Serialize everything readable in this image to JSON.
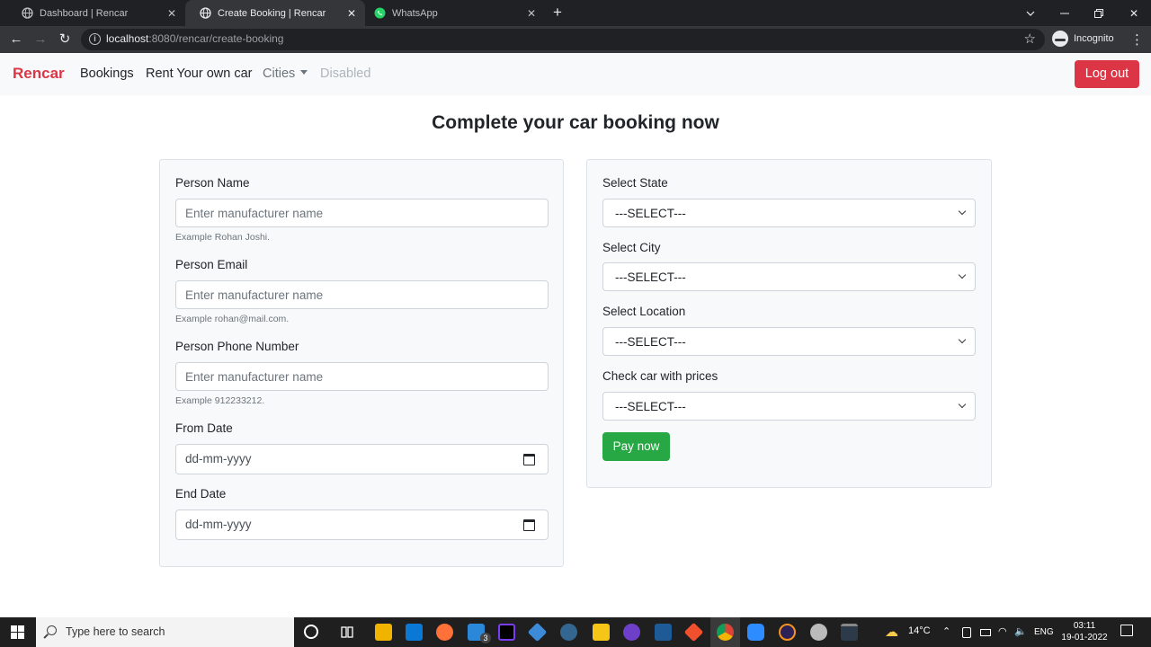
{
  "browser": {
    "tabs": [
      {
        "title": "Dashboard | Rencar",
        "active": false
      },
      {
        "title": "Create Booking | Rencar",
        "active": true
      },
      {
        "title": "WhatsApp",
        "active": false
      }
    ],
    "url_host": "localhost",
    "url_path": ":8080/rencar/create-booking",
    "profile_label": "Incognito"
  },
  "navbar": {
    "brand": "Rencar",
    "links": [
      "Bookings",
      "Rent Your own car",
      "Cities",
      "Disabled"
    ],
    "logout_label": "Log out"
  },
  "page": {
    "heading": "Complete your car booking now"
  },
  "left_form": {
    "person_name": {
      "label": "Person Name",
      "placeholder": "Enter manufacturer name",
      "help": "Example Rohan Joshi."
    },
    "person_email": {
      "label": "Person Email",
      "placeholder": "Enter manufacturer name",
      "help": "Example rohan@mail.com."
    },
    "person_phone": {
      "label": "Person Phone Number",
      "placeholder": "Enter manufacturer name",
      "help": "Example 912233212."
    },
    "from_date": {
      "label": "From Date",
      "value": "dd-mm-yyyy"
    },
    "end_date": {
      "label": "End Date",
      "value": "dd-mm-yyyy"
    }
  },
  "right_form": {
    "state": {
      "label": "Select State",
      "selected": "---SELECT---"
    },
    "city": {
      "label": "Select City",
      "selected": "---SELECT---"
    },
    "location": {
      "label": "Select Location",
      "selected": "---SELECT---"
    },
    "car": {
      "label": "Check car with prices",
      "selected": "---SELECT---"
    },
    "pay_label": "Pay now"
  },
  "taskbar": {
    "search_placeholder": "Type here to search",
    "mail_badge": "3",
    "weather": "14°C",
    "language": "ENG",
    "time": "03:11",
    "date": "19-01-2022"
  },
  "colors": {
    "brand": "#dc3545",
    "success": "#28a745",
    "browser_dark": "#202124"
  }
}
